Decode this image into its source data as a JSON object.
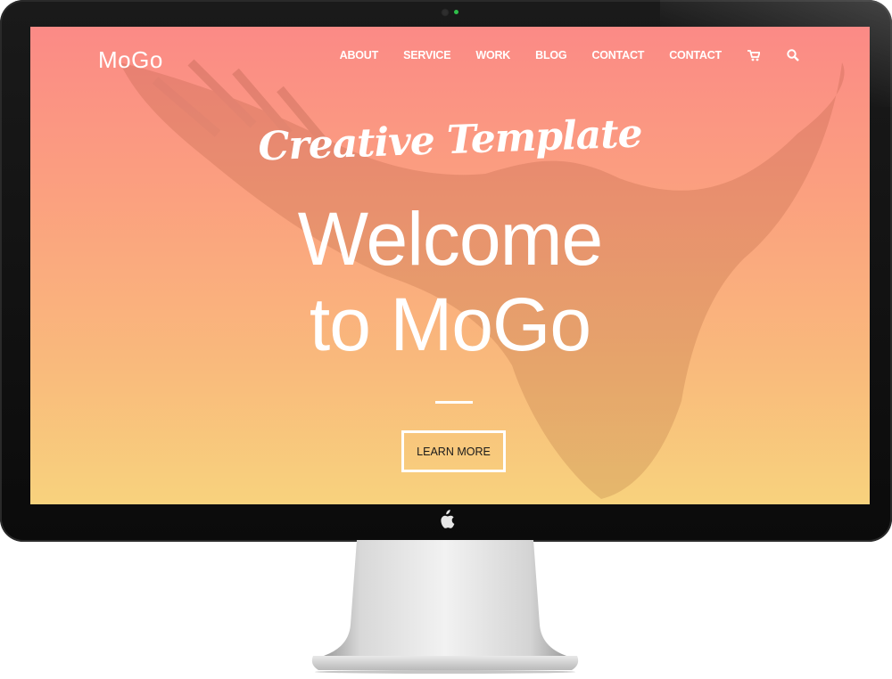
{
  "header": {
    "logo": "MoGo",
    "nav": [
      {
        "label": "ABOUT"
      },
      {
        "label": "SERVICE"
      },
      {
        "label": "WORK"
      },
      {
        "label": "BLOG"
      },
      {
        "label": "CONTACT"
      },
      {
        "label": "CONTACT"
      }
    ],
    "icons": [
      "cart-icon",
      "search-icon"
    ]
  },
  "hero": {
    "script_title": "Creative Template",
    "heading_line1": "Welcome",
    "heading_line2": "to MoGo",
    "cta_label": "LEARN MORE"
  },
  "colors": {
    "gradient_top": "#fb8a86",
    "gradient_bottom": "#f8d27d",
    "text": "#ffffff"
  },
  "device": {
    "type": "desktop-monitor",
    "badge": "apple-logo-icon"
  }
}
